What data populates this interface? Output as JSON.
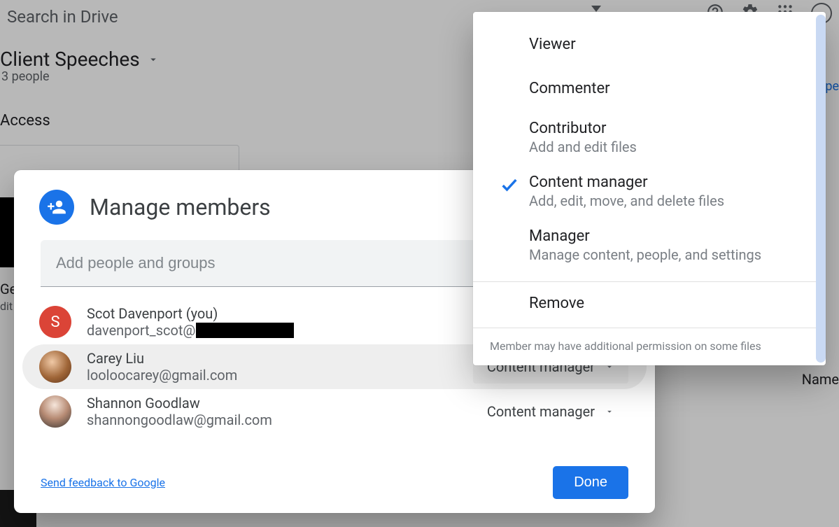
{
  "backdrop": {
    "search_placeholder": "Search in Drive",
    "folder_name": "Client Speeches",
    "people_count": "3 people",
    "section_label": "Access",
    "ge": "Ge",
    "dit": "dit",
    "pe": "pe",
    "column_name": "Name"
  },
  "modal": {
    "title": "Manage members",
    "input_placeholder": "Add people and groups",
    "members": [
      {
        "initial": "S",
        "name": "Scot Davenport (you)",
        "email_prefix": "davenport_scot@",
        "role": ""
      },
      {
        "name": "Carey Liu",
        "email": "looloocarey@gmail.com",
        "role": "Content manager",
        "selected": true
      },
      {
        "name": "Shannon Goodlaw",
        "email": "shannongoodlaw@gmail.com",
        "role": "Content manager"
      }
    ],
    "feedback": "Send feedback to Google",
    "done": "Done"
  },
  "role_menu": {
    "options": [
      {
        "title": "Viewer",
        "desc": ""
      },
      {
        "title": "Commenter",
        "desc": ""
      },
      {
        "title": "Contributor",
        "desc": "Add and edit files"
      },
      {
        "title": "Content manager",
        "desc": "Add, edit, move, and delete files",
        "selected": true
      },
      {
        "title": "Manager",
        "desc": "Manage content, people, and settings"
      }
    ],
    "remove": "Remove",
    "footer": "Member may have additional permission on some files"
  }
}
